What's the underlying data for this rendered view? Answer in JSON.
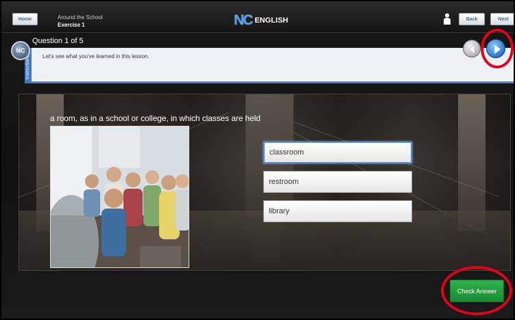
{
  "header": {
    "home_label": "Home",
    "lesson_title": "Around the School",
    "lesson_subtitle": "Exercise 1",
    "logo_mark": "NC",
    "logo_text": "ENGLISH",
    "back_label": "Back",
    "next_label": "Next"
  },
  "question": {
    "counter": "Question 1 of 5",
    "badge": "NC",
    "instructions_tab": "Instructions",
    "instructions_text": "Let's see what you've learned in this lesson.",
    "prompt": "a room, as in a school or college, in which classes are held"
  },
  "answers": [
    {
      "label": "classroom",
      "selected": true
    },
    {
      "label": "restroom",
      "selected": false
    },
    {
      "label": "library",
      "selected": false
    }
  ],
  "actions": {
    "check_label": "Check Answer"
  },
  "colors": {
    "accent_blue": "#3f7ac0",
    "check_green": "#1f9a3b",
    "highlight_red": "#e3001b"
  }
}
